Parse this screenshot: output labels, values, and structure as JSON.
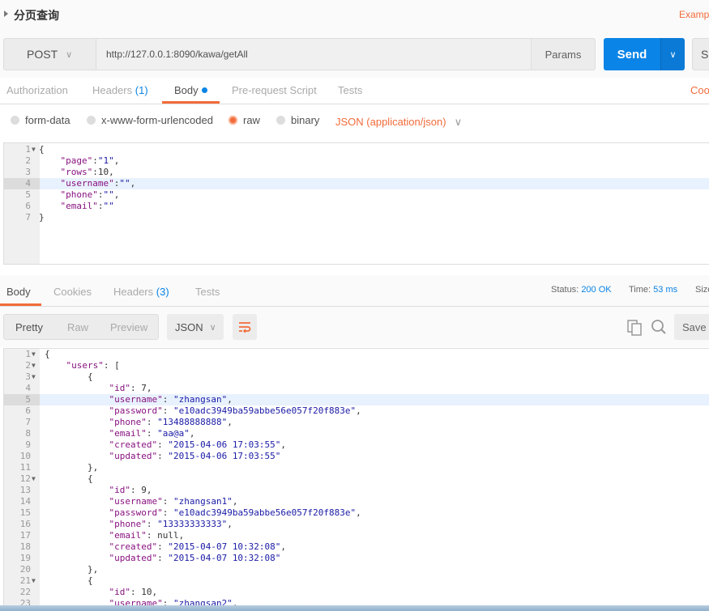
{
  "header": {
    "title": "分页查询",
    "examples_link": "Examp"
  },
  "request": {
    "method": "POST",
    "url": "http://127.0.0.1:8090/kawa/getAll",
    "params_label": "Params",
    "send_label": "Send",
    "save_label": "Sa"
  },
  "req_tabs": [
    {
      "label": "Authorization"
    },
    {
      "label": "Headers",
      "count": "(1)"
    },
    {
      "label": "Body"
    },
    {
      "label": "Pre-request Script"
    },
    {
      "label": "Tests"
    }
  ],
  "cookies_link": "Coo",
  "body_types": [
    {
      "label": "form-data",
      "selected": false
    },
    {
      "label": "x-www-form-urlencoded",
      "selected": false
    },
    {
      "label": "raw",
      "selected": true
    },
    {
      "label": "binary",
      "selected": false
    }
  ],
  "content_type": "JSON (application/json)",
  "request_body": {
    "highlight_line": 4,
    "fold_lines": [
      1
    ],
    "lines": [
      "{",
      "    \"page\":\"1\",",
      "    \"rows\":10,",
      "    \"username\":\"\",",
      "    \"phone\":\"\",",
      "    \"email\":\"\"",
      "}"
    ]
  },
  "resp_tabs": [
    {
      "label": "Body"
    },
    {
      "label": "Cookies"
    },
    {
      "label": "Headers",
      "count": "(3)"
    },
    {
      "label": "Tests"
    }
  ],
  "status": {
    "status_label": "Status:",
    "status_value": "200 OK",
    "time_label": "Time:",
    "time_value": "53 ms",
    "size_label": "Size"
  },
  "resp_toolbar": {
    "views": [
      "Pretty",
      "Raw",
      "Preview"
    ],
    "format": "JSON",
    "save_label": "Save R"
  },
  "colors": {
    "accent": "#f26b3a",
    "primary": "#0a84e6",
    "json_key": "#881280",
    "json_string": "#1a1aa6"
  },
  "response_body": {
    "highlight_line": 5,
    "fold_lines": [
      1,
      2,
      3,
      12,
      21
    ],
    "lines": [
      "{",
      "    \"users\": [",
      "        {",
      "            \"id\": 7,",
      "            \"username\": \"zhangsan\",",
      "            \"password\": \"e10adc3949ba59abbe56e057f20f883e\",",
      "            \"phone\": \"13488888888\",",
      "            \"email\": \"aa@a\",",
      "            \"created\": \"2015-04-06 17:03:55\",",
      "            \"updated\": \"2015-04-06 17:03:55\"",
      "        },",
      "        {",
      "            \"id\": 9,",
      "            \"username\": \"zhangsan1\",",
      "            \"password\": \"e10adc3949ba59abbe56e057f20f883e\",",
      "            \"phone\": \"13333333333\",",
      "            \"email\": null,",
      "            \"created\": \"2015-04-07 10:32:08\",",
      "            \"updated\": \"2015-04-07 10:32:08\"",
      "        },",
      "        {",
      "            \"id\": 10,",
      "            \"username\": \"zhangsan2\","
    ]
  }
}
